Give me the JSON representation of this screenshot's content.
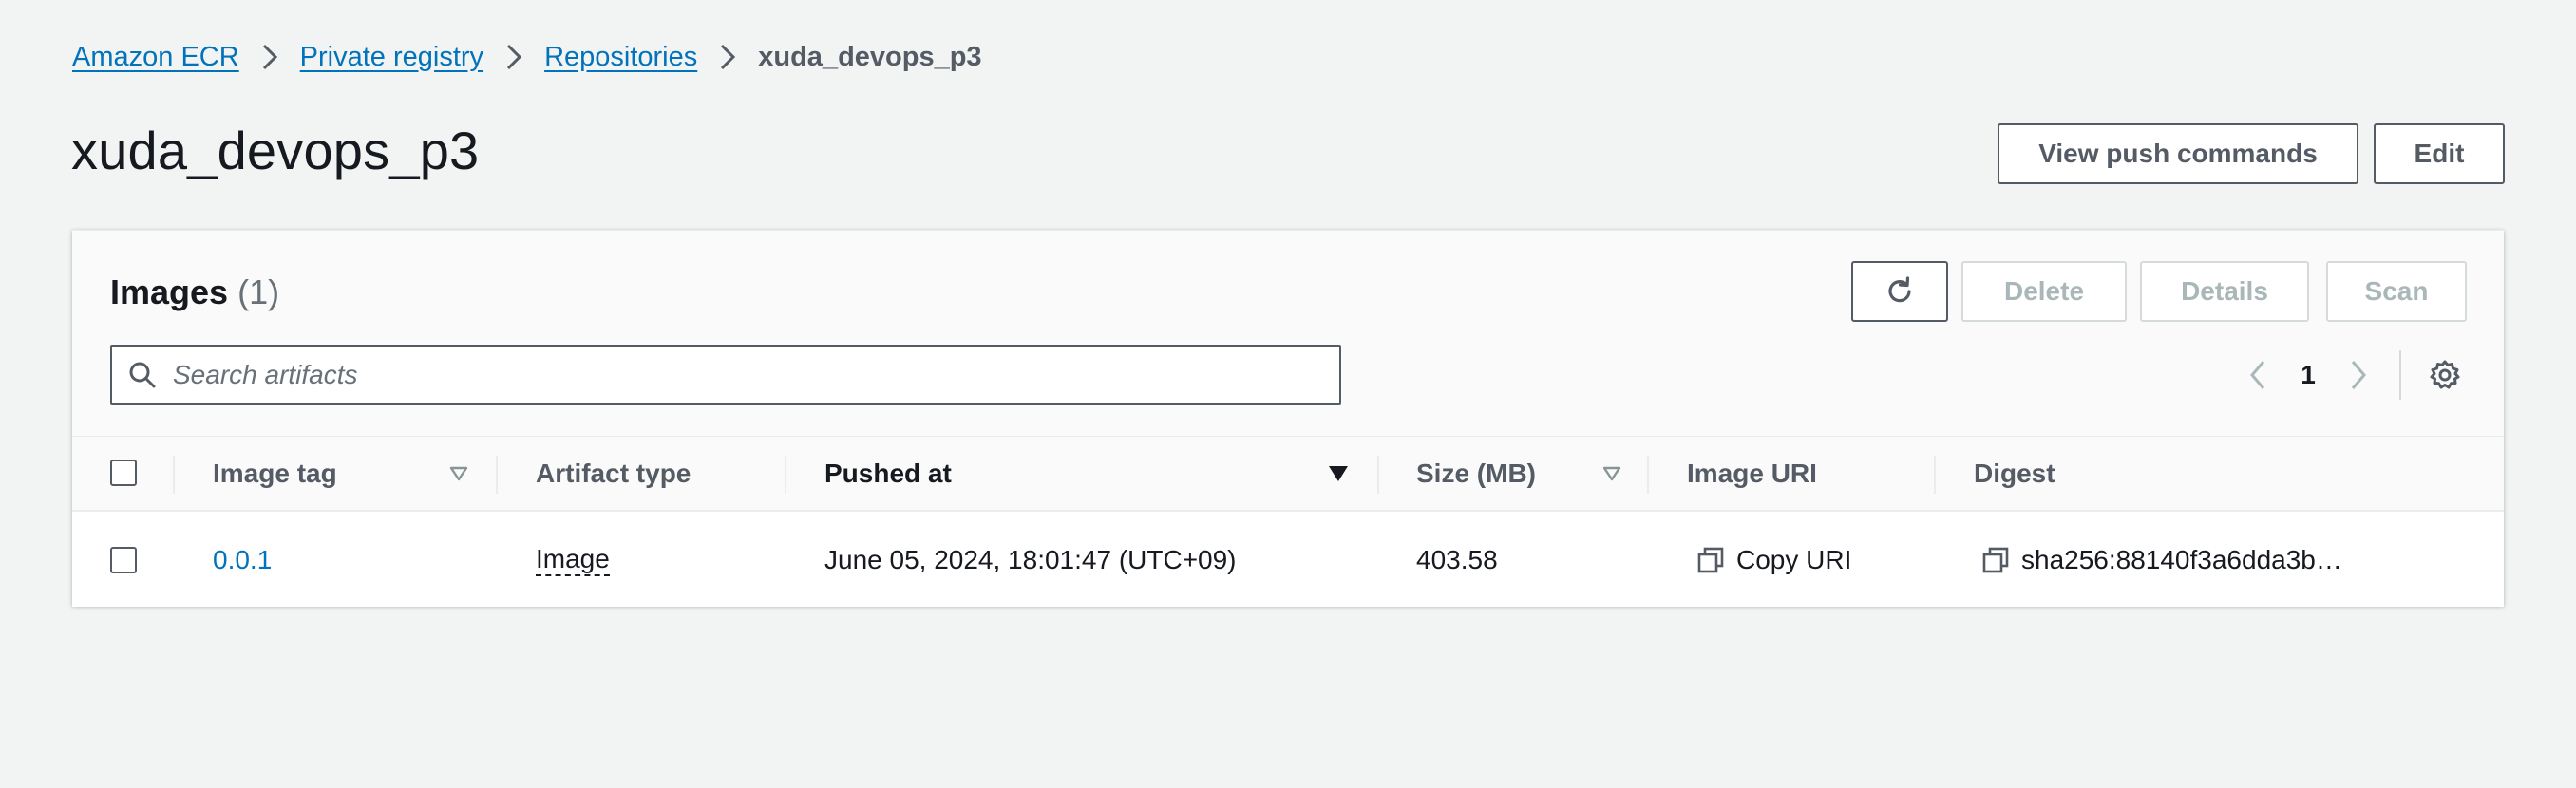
{
  "breadcrumb": {
    "items": [
      "Amazon ECR",
      "Private registry",
      "Repositories"
    ],
    "current": "xuda_devops_p3"
  },
  "page": {
    "title": "xuda_devops_p3",
    "buttons": {
      "view_push_commands": "View push commands",
      "edit": "Edit"
    }
  },
  "images_panel": {
    "title": "Images",
    "count": "(1)",
    "actions": {
      "delete": "Delete",
      "details": "Details",
      "scan": "Scan"
    },
    "search": {
      "placeholder": "Search artifacts",
      "value": ""
    },
    "pagination": {
      "current_page": "1"
    },
    "columns": [
      "Image tag",
      "Artifact type",
      "Pushed at",
      "Size (MB)",
      "Image URI",
      "Digest"
    ],
    "rows": [
      {
        "image_tag": "0.0.1",
        "artifact_type": "Image",
        "pushed_at": "June 05, 2024, 18:01:47 (UTC+09)",
        "size_mb": "403.58",
        "image_uri": "Copy URI",
        "digest": "sha256:88140f3a6dda3b…"
      }
    ]
  },
  "icons": {
    "breadcrumb_separator": "chevron-right-icon",
    "refresh": "refresh-icon",
    "search": "search-icon",
    "prev": "chevron-left-icon",
    "next": "chevron-right-icon",
    "settings": "gear-icon",
    "sort": "caret-down-icon",
    "copy": "copy-icon"
  },
  "colors": {
    "background": "#f2f3f3",
    "link": "#0073bb",
    "text": "#16191f",
    "muted": "#545b64",
    "disabled": "#aab7b8"
  }
}
